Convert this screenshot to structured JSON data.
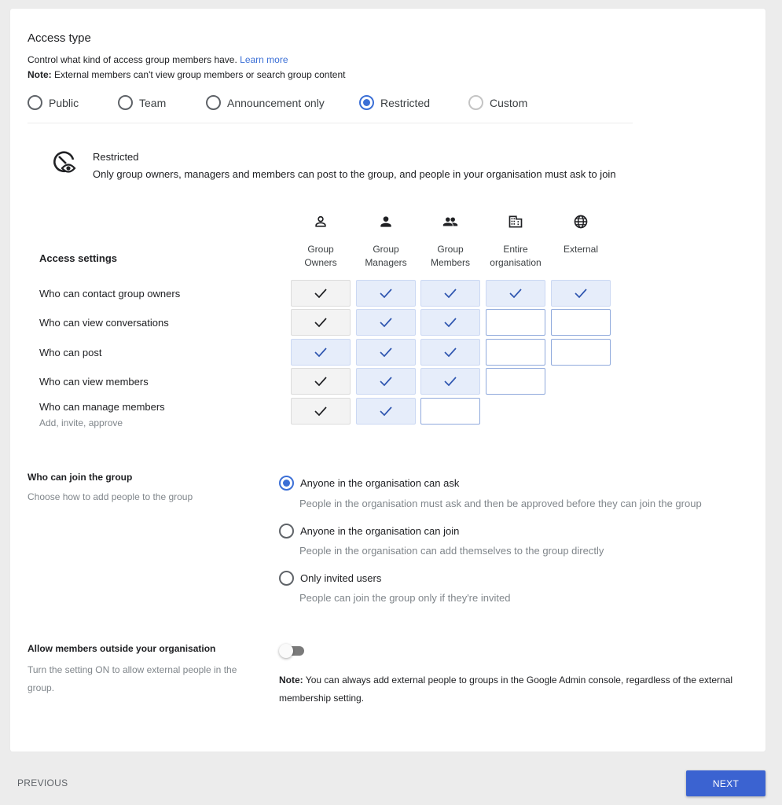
{
  "access_type": {
    "title": "Access type",
    "description": "Control what kind of access group members have.",
    "learn_more": "Learn more",
    "note_label": "Note:",
    "note_text": "External members can't view group members or search group content",
    "options": [
      {
        "label": "Public",
        "state": "unchecked"
      },
      {
        "label": "Team",
        "state": "unchecked"
      },
      {
        "label": "Announcement only",
        "state": "unchecked"
      },
      {
        "label": "Restricted",
        "state": "checked"
      },
      {
        "label": "Custom",
        "state": "disabled"
      }
    ],
    "selected": "Restricted"
  },
  "restricted_info": {
    "icon": "visibility-restricted-icon",
    "title": "Restricted",
    "description": "Only group owners, managers and members can post to the group, and people in your organisation must ask to join"
  },
  "access_settings": {
    "title": "Access settings",
    "columns": [
      {
        "label_line1": "Group",
        "label_line2": "Owners",
        "icon": "person-outline-icon"
      },
      {
        "label_line1": "Group",
        "label_line2": "Managers",
        "icon": "person-icon"
      },
      {
        "label_line1": "Group",
        "label_line2": "Members",
        "icon": "people-icon"
      },
      {
        "label_line1": "Entire",
        "label_line2": "organisation",
        "icon": "building-icon"
      },
      {
        "label_line1": "External",
        "label_line2": "",
        "icon": "globe-icon"
      }
    ],
    "rows": [
      {
        "label": "Who can contact group owners",
        "sublabel": "",
        "cells": [
          "locked",
          "on",
          "on",
          "on",
          "on"
        ]
      },
      {
        "label": "Who can view conversations",
        "sublabel": "",
        "cells": [
          "locked",
          "on",
          "on",
          "off",
          "off"
        ]
      },
      {
        "label": "Who can post",
        "sublabel": "",
        "cells": [
          "on",
          "on",
          "on",
          "off",
          "off"
        ]
      },
      {
        "label": "Who can view members",
        "sublabel": "",
        "cells": [
          "locked",
          "on",
          "on",
          "off",
          null
        ]
      },
      {
        "label": "Who can manage members",
        "sublabel": "Add, invite, approve",
        "cells": [
          "locked",
          "on",
          "off",
          null,
          null
        ]
      }
    ]
  },
  "join": {
    "title": "Who can join the group",
    "subtitle": "Choose how to add people to the group",
    "options": [
      {
        "label": "Anyone in the organisation can ask",
        "description": "People in the organisation must ask and then be approved before they can join the group",
        "checked": true
      },
      {
        "label": "Anyone in the organisation can join",
        "description": "People in the organisation can add themselves to the group directly",
        "checked": false
      },
      {
        "label": "Only invited users",
        "description": "People can join the group only if they're invited",
        "checked": false
      }
    ]
  },
  "external_members": {
    "title": "Allow members outside your organisation",
    "subtitle": "Turn the setting ON to allow external people in the group.",
    "toggle_on": false,
    "note_label": "Note:",
    "note_text": "You can always add external people to groups in the Google Admin console, regardless of the external membership setting."
  },
  "footer": {
    "previous_label": "PREVIOUS",
    "next_label": "NEXT"
  },
  "colors": {
    "accent": "#3b6fd6",
    "button": "#3b63d1",
    "checked_cell_bg": "#e6edfa",
    "locked_cell_bg": "#f3f3f3"
  }
}
